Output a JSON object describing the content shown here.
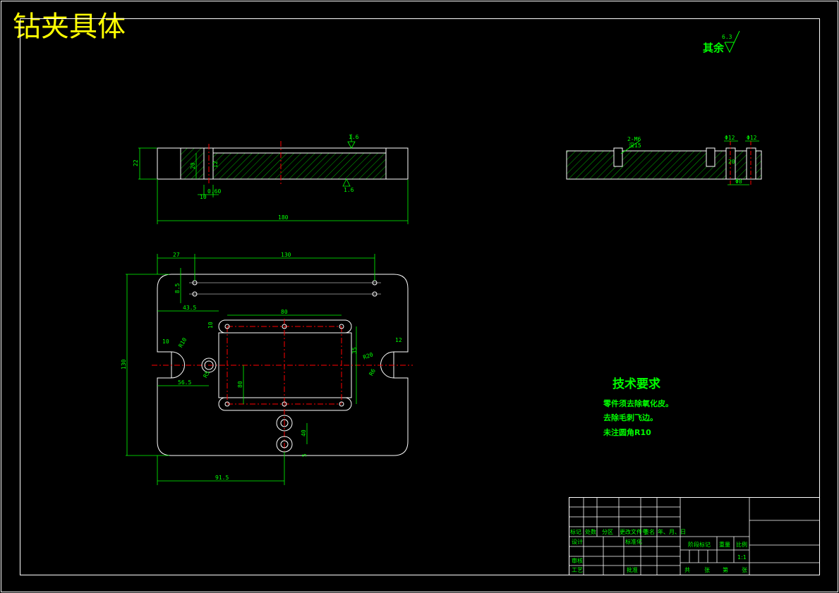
{
  "drawing": {
    "title": "钻夹具体",
    "surface_finish": {
      "prefix": "其余",
      "value": "6.3"
    },
    "colors": {
      "outline": "#ffffff",
      "dimension": "#00ff00",
      "centerline": "#ff0000",
      "title": "#ffff00",
      "background": "#000000"
    }
  },
  "front_view": {
    "height_dim": "22",
    "inner_dim": "20",
    "slot_dim": "12",
    "depth_dim": "0.60",
    "offset_dim": "10",
    "finish_top": "1.6",
    "finish_bottom": "1.6",
    "length_dim": "180"
  },
  "side_view": {
    "thread_label": "2-M6",
    "thread_depth": "深15",
    "hole1_dim": "Φ12",
    "hole2_dim": "Φ12",
    "bore_dim": "Φ8",
    "depth_dim": "20"
  },
  "plan_view": {
    "dims": {
      "left_offset": "27",
      "hole_span": "130",
      "hole_pitch": "8.5",
      "slot_offset": "43.5",
      "slot_span": "80",
      "slot_width": "10",
      "radius_left": "R10",
      "left_width": "10",
      "center_dist": "56.5",
      "small_r": "R5",
      "overall_height": "130",
      "rect_height": "35",
      "inner_height": "80",
      "right_width": "12",
      "radius_right": "R20",
      "right_hole": "R6",
      "bottom_offset": "40",
      "bottom_gap": "5",
      "bottom_dist": "91.5"
    }
  },
  "tech_requirements": {
    "heading": "技术要求",
    "items": [
      "零件须去除氧化皮。",
      "去除毛刺飞边。",
      "未注圆角R10"
    ]
  },
  "title_block": {
    "row_labels": [
      "标记",
      "处数",
      "分区",
      "更改文件号",
      "签名",
      "年、月、日"
    ],
    "design": "设计",
    "standardize": "标准化",
    "review": "审核",
    "process": "工艺",
    "approve": "批准",
    "stage_mark": "阶段标记",
    "weight": "重量",
    "scale_label": "比例",
    "scale_value": "1:1",
    "sheet_total": "共",
    "sheet_unit": "张",
    "sheet_no": "第",
    "sheet_unit2": "张"
  }
}
